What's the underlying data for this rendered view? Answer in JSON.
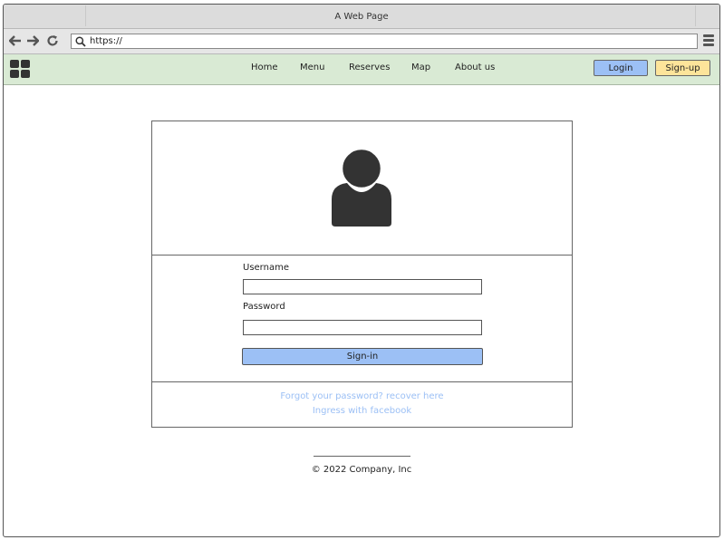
{
  "browser": {
    "title": "A Web Page",
    "url": "https://"
  },
  "nav": {
    "links": [
      "Home",
      "Menu",
      "Reserves",
      "Map",
      "About us"
    ],
    "login_label": "Login",
    "signup_label": "Sign-up"
  },
  "login_form": {
    "username_label": "Username",
    "username_value": "",
    "password_label": "Password",
    "password_value": "",
    "signin_label": "Sign-in",
    "forgot_link": "Forgot your password? recover here",
    "facebook_link": "Ingress with facebook"
  },
  "footer": {
    "copyright": "© 2022 Company, Inc"
  },
  "colors": {
    "nav_bg": "#d9ead4",
    "login_button": "#9cc0f5",
    "signup_button": "#fde49a",
    "link": "#9cc0f5"
  }
}
